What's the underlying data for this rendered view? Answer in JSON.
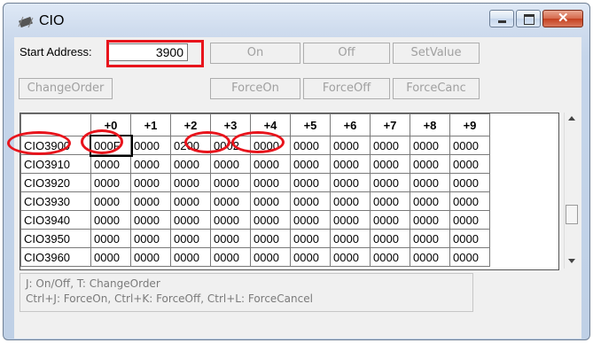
{
  "window": {
    "title": "CIO"
  },
  "toolbar": {
    "start_address_label": "Start Address:",
    "start_address_value": "3900",
    "on_label": "On",
    "off_label": "Off",
    "setvalue_label": "SetValue",
    "changeorder_label": "ChangeOrder",
    "forceon_label": "ForceOn",
    "forceoff_label": "ForceOff",
    "forcecanc_label": "ForceCanc"
  },
  "table": {
    "headers": [
      "",
      "+0",
      "+1",
      "+2",
      "+3",
      "+4",
      "+5",
      "+6",
      "+7",
      "+8",
      "+9"
    ],
    "rows": [
      {
        "addr": "CIO3900",
        "cells": [
          "000F",
          "0000",
          "0200",
          "0002",
          "0000",
          "0000",
          "0000",
          "0000",
          "0000",
          "0000"
        ]
      },
      {
        "addr": "CIO3910",
        "cells": [
          "0000",
          "0000",
          "0000",
          "0000",
          "0000",
          "0000",
          "0000",
          "0000",
          "0000",
          "0000"
        ]
      },
      {
        "addr": "CIO3920",
        "cells": [
          "0000",
          "0000",
          "0000",
          "0000",
          "0000",
          "0000",
          "0000",
          "0000",
          "0000",
          "0000"
        ]
      },
      {
        "addr": "CIO3930",
        "cells": [
          "0000",
          "0000",
          "0000",
          "0000",
          "0000",
          "0000",
          "0000",
          "0000",
          "0000",
          "0000"
        ]
      },
      {
        "addr": "CIO3940",
        "cells": [
          "0000",
          "0000",
          "0000",
          "0000",
          "0000",
          "0000",
          "0000",
          "0000",
          "0000",
          "0000"
        ]
      },
      {
        "addr": "CIO3950",
        "cells": [
          "0000",
          "0000",
          "0000",
          "0000",
          "0000",
          "0000",
          "0000",
          "0000",
          "0000",
          "0000"
        ]
      },
      {
        "addr": "CIO3960",
        "cells": [
          "0000",
          "0000",
          "0000",
          "0000",
          "0000",
          "0000",
          "0000",
          "0000",
          "0000",
          "0000"
        ]
      }
    ]
  },
  "hint": {
    "line1": "J: On/Off,   T: ChangeOrder",
    "line2": "Ctrl+J: ForceOn,   Ctrl+K: ForceOff,   Ctrl+L: ForceCancel"
  },
  "colors": {
    "highlight": "#e8141c"
  }
}
